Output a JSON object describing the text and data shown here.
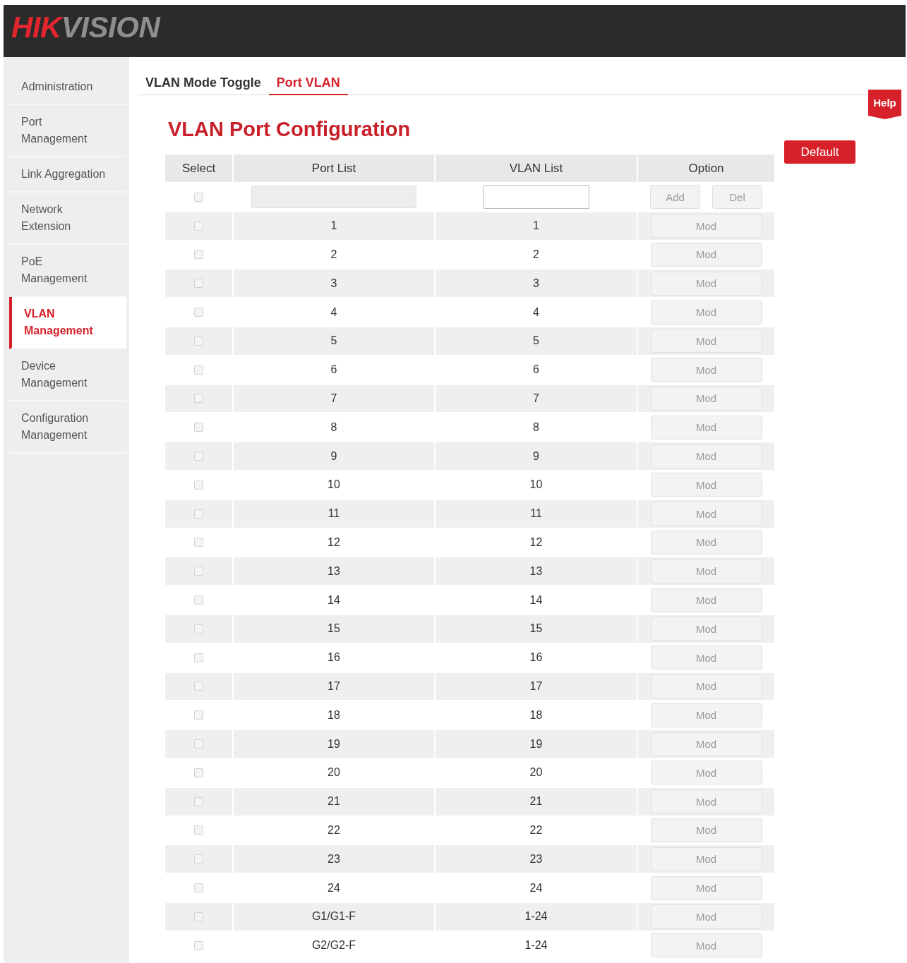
{
  "header": {
    "logo": {
      "parts": [
        {
          "text": "HIK",
          "color": "#e3262d"
        },
        {
          "text": "VISION",
          "color": "#8e8e8e"
        }
      ]
    }
  },
  "sidebar": {
    "items": [
      {
        "label": "Administration",
        "selected": false
      },
      {
        "label": "Port\nManagement",
        "selected": false
      },
      {
        "label": "Link Aggregation",
        "selected": false
      },
      {
        "label": "Network\nExtension",
        "selected": false
      },
      {
        "label": "PoE\nManagement",
        "selected": false
      },
      {
        "label": "VLAN\nManagement",
        "selected": true
      },
      {
        "label": "Device\nManagement",
        "selected": false
      },
      {
        "label": "Configuration\nManagement",
        "selected": false
      }
    ]
  },
  "tabs": [
    {
      "label": "VLAN Mode Toggle",
      "selected": false
    },
    {
      "label": "Port VLAN",
      "selected": true
    }
  ],
  "help": {
    "label": "Help"
  },
  "title": "VLAN Port Configuration",
  "default_button": {
    "label": "Default"
  },
  "table": {
    "columns": [
      "Select",
      "Port List",
      "VLAN List",
      "Option"
    ],
    "new_row": {
      "checked": false,
      "port_field": {
        "disabled": true
      },
      "buttons": [
        {
          "label": "Add",
          "disabled": true
        },
        {
          "label": "Del",
          "disabled": true
        }
      ]
    },
    "rows": [
      {
        "checked": false,
        "port_list": "1",
        "vlan_list": "1",
        "button": {
          "label": "Mod",
          "disabled": true
        }
      },
      {
        "checked": false,
        "port_list": "2",
        "vlan_list": "2",
        "button": {
          "label": "Mod",
          "disabled": true
        }
      },
      {
        "checked": false,
        "port_list": "3",
        "vlan_list": "3",
        "button": {
          "label": "Mod",
          "disabled": true
        }
      },
      {
        "checked": false,
        "port_list": "4",
        "vlan_list": "4",
        "button": {
          "label": "Mod",
          "disabled": true
        }
      },
      {
        "checked": false,
        "port_list": "5",
        "vlan_list": "5",
        "button": {
          "label": "Mod",
          "disabled": true
        }
      },
      {
        "checked": false,
        "port_list": "6",
        "vlan_list": "6",
        "button": {
          "label": "Mod",
          "disabled": true
        }
      },
      {
        "checked": false,
        "port_list": "7",
        "vlan_list": "7",
        "button": {
          "label": "Mod",
          "disabled": true
        }
      },
      {
        "checked": false,
        "port_list": "8",
        "vlan_list": "8",
        "button": {
          "label": "Mod",
          "disabled": true
        }
      },
      {
        "checked": false,
        "port_list": "9",
        "vlan_list": "9",
        "button": {
          "label": "Mod",
          "disabled": true
        }
      },
      {
        "checked": false,
        "port_list": "10",
        "vlan_list": "10",
        "button": {
          "label": "Mod",
          "disabled": true
        }
      },
      {
        "checked": false,
        "port_list": "11",
        "vlan_list": "11",
        "button": {
          "label": "Mod",
          "disabled": true
        }
      },
      {
        "checked": false,
        "port_list": "12",
        "vlan_list": "12",
        "button": {
          "label": "Mod",
          "disabled": true
        }
      },
      {
        "checked": false,
        "port_list": "13",
        "vlan_list": "13",
        "button": {
          "label": "Mod",
          "disabled": true
        }
      },
      {
        "checked": false,
        "port_list": "14",
        "vlan_list": "14",
        "button": {
          "label": "Mod",
          "disabled": true
        }
      },
      {
        "checked": false,
        "port_list": "15",
        "vlan_list": "15",
        "button": {
          "label": "Mod",
          "disabled": true
        }
      },
      {
        "checked": false,
        "port_list": "16",
        "vlan_list": "16",
        "button": {
          "label": "Mod",
          "disabled": true
        }
      },
      {
        "checked": false,
        "port_list": "17",
        "vlan_list": "17",
        "button": {
          "label": "Mod",
          "disabled": true
        }
      },
      {
        "checked": false,
        "port_list": "18",
        "vlan_list": "18",
        "button": {
          "label": "Mod",
          "disabled": true
        }
      },
      {
        "checked": false,
        "port_list": "19",
        "vlan_list": "19",
        "button": {
          "label": "Mod",
          "disabled": true
        }
      },
      {
        "checked": false,
        "port_list": "20",
        "vlan_list": "20",
        "button": {
          "label": "Mod",
          "disabled": true
        }
      },
      {
        "checked": false,
        "port_list": "21",
        "vlan_list": "21",
        "button": {
          "label": "Mod",
          "disabled": true
        }
      },
      {
        "checked": false,
        "port_list": "22",
        "vlan_list": "22",
        "button": {
          "label": "Mod",
          "disabled": true
        }
      },
      {
        "checked": false,
        "port_list": "23",
        "vlan_list": "23",
        "button": {
          "label": "Mod",
          "disabled": true
        }
      },
      {
        "checked": false,
        "port_list": "24",
        "vlan_list": "24",
        "button": {
          "label": "Mod",
          "disabled": true
        }
      },
      {
        "checked": false,
        "port_list": "G1/G1-F",
        "vlan_list": "1-24",
        "button": {
          "label": "Mod",
          "disabled": true
        }
      },
      {
        "checked": false,
        "port_list": "G2/G2-F",
        "vlan_list": "1-24",
        "button": {
          "label": "Mod",
          "disabled": true
        }
      }
    ]
  }
}
